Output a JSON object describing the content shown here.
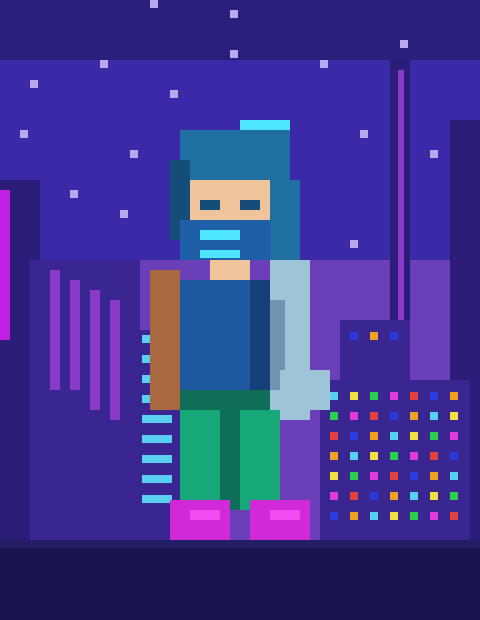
{
  "scene": {
    "subject": "cyberpunk-character-sprite",
    "style": "pixel-art",
    "colors": {
      "sky_top": "#2a1f7a",
      "sky_mid": "#3b2aa8",
      "sky_glow": "#5a3fd0",
      "haze": "#6a3fb8",
      "building_dark": "#2c1d78",
      "building_mid": "#3a2690",
      "neon_pink": "#c020e0",
      "neon_purple": "#8a3ac8",
      "street": "#1a1550",
      "street_edge": "#231d66",
      "hair": "#1f6fa0",
      "hair_dark": "#134d78",
      "skin": "#f0c49a",
      "mask": "#1e5fa8",
      "mask_glow": "#4ee6ff",
      "tank_top": "#1f5aa0",
      "tank_dark": "#163f78",
      "arm_skin": "#a86840",
      "cyber_arm": "#9ec4d8",
      "cyber_arm_dark": "#6f94b0",
      "pants": "#16a877",
      "pants_dark": "#0e6e58",
      "shoes": "#d02ad8",
      "shoes_light": "#f04cf0",
      "halo": "#4ee6ff"
    },
    "window_colors": [
      "#59d0f0",
      "#e03ad8",
      "#f0a020",
      "#2ad04a",
      "#2a3ae0",
      "#f0e040",
      "#e04040"
    ]
  }
}
